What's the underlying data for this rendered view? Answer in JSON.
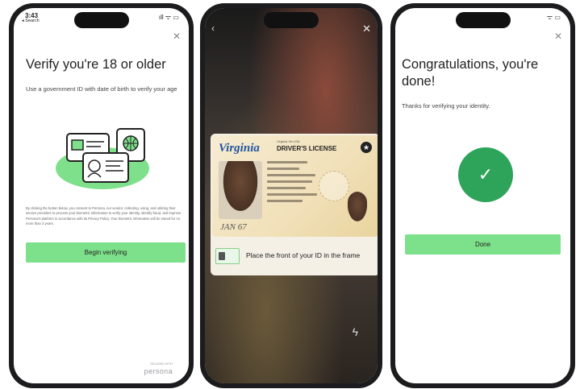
{
  "screen1": {
    "status_time": "3:43",
    "status_back": "◂ Search",
    "status_icons": "ıll ᯤ ▭",
    "close_icon": "✕",
    "title": "Verify you're 18 or older",
    "body": "Use a government ID with date of birth to verify your age",
    "fine_print": "By clicking the button below, you consent to Persona, our vendor, collecting, using, and utilizing their service providers to process your biometric information to verify your identity, identify fraud, and improve Persona's platform in accordance with its Privacy Policy. Your biometric information will be stored for no more than 3 years.",
    "button_label": "Begin verifying",
    "secured_with": "SECURED WITH",
    "logo": "persona"
  },
  "screen2": {
    "back_icon": "‹",
    "close_icon": "✕",
    "license": {
      "state": "Virginia",
      "header": "DRIVER'S LICENSE",
      "subheader": "Virginia  VA USA",
      "signature": "JAN 67"
    },
    "caption": "Place the front of your ID in the frame",
    "flash_icon": "ϟ"
  },
  "screen3": {
    "status_icons": "ᯤ ▭",
    "close_icon": "✕",
    "title": "Congratulations, you're done!",
    "body": "Thanks for verifying your identity.",
    "check_icon": "✓",
    "button_label": "Done"
  }
}
